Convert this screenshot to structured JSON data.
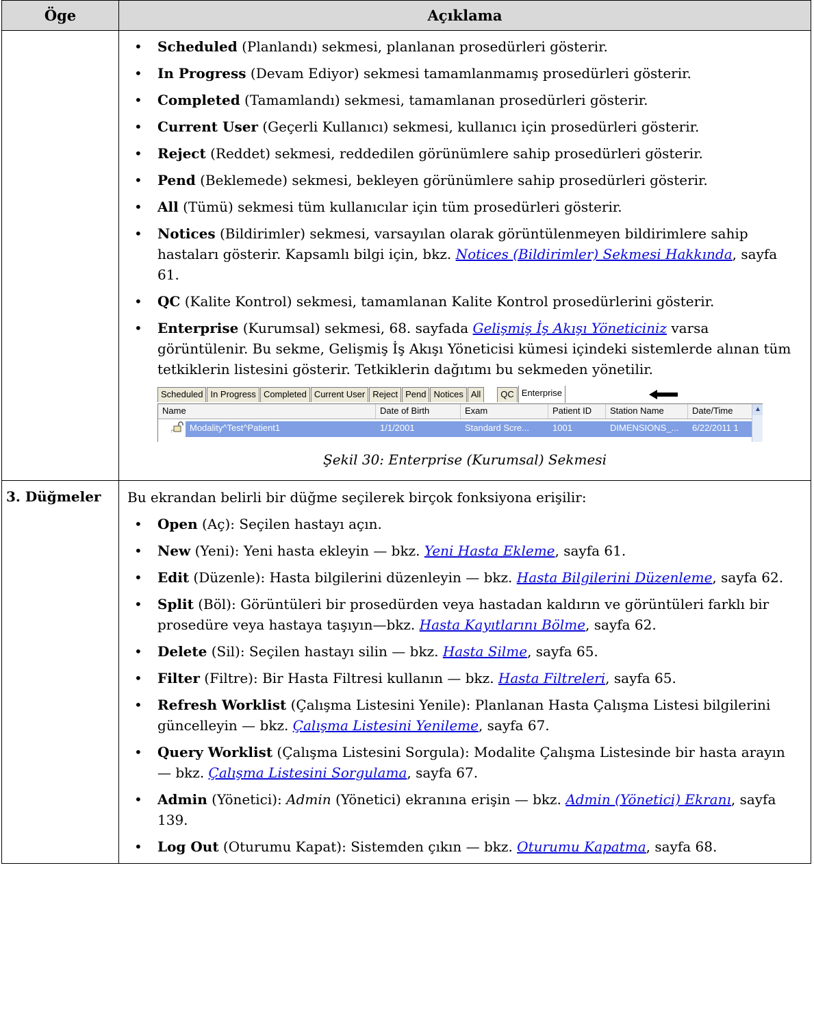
{
  "header": {
    "col1": "Öge",
    "col2": "Açıklama"
  },
  "tabs_section": {
    "items": [
      {
        "bold": "Scheduled",
        "rest": " (Planlandı) sekmesi, planlanan prosedürleri gösterir."
      },
      {
        "bold": "In Progress",
        "rest": " (Devam Ediyor) sekmesi tamamlanmamış prosedürleri gösterir."
      },
      {
        "bold": "Completed",
        "rest": " (Tamamlandı) sekmesi, tamamlanan prosedürleri gösterir."
      },
      {
        "bold": "Current User",
        "rest": " (Geçerli Kullanıcı) sekmesi, kullanıcı için prosedürleri gösterir."
      },
      {
        "bold": "Reject",
        "rest": " (Reddet) sekmesi, reddedilen görünümlere sahip prosedürleri gösterir."
      },
      {
        "bold": "Pend",
        "rest": " (Beklemede) sekmesi, bekleyen görünümlere sahip prosedürleri gösterir."
      },
      {
        "bold": "All",
        "rest": " (Tümü) sekmesi tüm kullanıcılar için tüm prosedürleri gösterir."
      },
      {
        "bold": "Notices",
        "rest": " (Bildirimler) sekmesi, varsayılan olarak görüntülenmeyen bildirimlere sahip hastaları gösterir. Kapsamlı bilgi için, bkz. ",
        "link": "Notices (Bildirimler) Sekmesi Hakkında",
        "after": ", sayfa 61."
      },
      {
        "bold": "QC",
        "rest": " (Kalite Kontrol) sekmesi, tamamlanan Kalite Kontrol prosedürlerini gösterir."
      },
      {
        "bold": "Enterprise",
        "rest": " (Kurumsal) sekmesi, 68. sayfada ",
        "link": "Gelişmiş İş Akışı Yöneticiniz",
        "after": " varsa görüntülenir. Bu sekme, Gelişmiş İş Akışı Yöneticisi kümesi içindeki sistemlerde alınan tüm tetkiklerin listesini gösterir. Tetkiklerin dağıtımı bu sekmeden yönetilir."
      }
    ],
    "figure": {
      "tabs": [
        "Scheduled",
        "In Progress",
        "Completed",
        "Current User",
        "Reject",
        "Pend",
        "Notices",
        "All",
        "QC",
        "Enterprise"
      ],
      "active_tab": "Enterprise",
      "columns": [
        "Name",
        "Date of Birth",
        "Exam",
        "Patient ID",
        "Station Name",
        "Date/Time"
      ],
      "row": [
        "Modality^Test^Patient1",
        "1/1/2001",
        "Standard Scre...",
        "1001",
        "DIMENSIONS_...",
        "6/22/2011 1"
      ],
      "row_color": "#7f9ee3",
      "caption": "Şekil 30: Enterprise (Kurumsal) Sekmesi"
    }
  },
  "buttons_section": {
    "label": "3. Düğmeler",
    "intro": "Bu ekrandan belirli bir düğme seçilerek birçok fonksiyona erişilir:",
    "items": [
      {
        "bold": "Open",
        "rest": " (Aç): Seçilen hastayı açın."
      },
      {
        "bold": "New",
        "rest": " (Yeni): Yeni hasta ekleyin — bkz. ",
        "link": "Yeni Hasta Ekleme",
        "after": ", sayfa 61."
      },
      {
        "bold": "Edit",
        "rest": " (Düzenle): Hasta bilgilerini düzenleyin — bkz. ",
        "link": "Hasta Bilgilerini Düzenleme",
        "after": ", sayfa 62."
      },
      {
        "bold": "Split",
        "rest": " (Böl): Görüntüleri bir prosedürden veya hastadan kaldırın ve görüntüleri farklı bir prosedüre veya hastaya taşıyın—bkz. ",
        "link": "Hasta Kayıtlarını Bölme",
        "after": ", sayfa 62."
      },
      {
        "bold": "Delete",
        "rest": " (Sil): Seçilen hastayı silin — bkz. ",
        "link": "Hasta Silme",
        "after": ", sayfa 65."
      },
      {
        "bold": "Filter",
        "rest": " (Filtre): Bir Hasta Filtresi kullanın — bkz. ",
        "link": "Hasta Filtreleri",
        "after": ", sayfa 65."
      },
      {
        "bold": "Refresh Worklist",
        "rest": " (Çalışma Listesini Yenile): Planlanan Hasta Çalışma Listesi bilgilerini güncelleyin — bkz. ",
        "link": "Çalışma Listesini Yenileme",
        "after": ", sayfa 67."
      },
      {
        "bold": "Query Worklist",
        "rest": " (Çalışma Listesini Sorgula): Modalite Çalışma Listesinde bir hasta arayın — bkz. ",
        "link": "Çalışma Listesini Sorgulama",
        "after": ", sayfa 67."
      },
      {
        "bold": "Admin",
        "rest": " (Yönetici): ",
        "ital": "Admin",
        "rest2": " (Yönetici) ekranına erişin — bkz. ",
        "link": "Admin (Yönetici) Ekranı",
        "after": ", sayfa 139."
      },
      {
        "bold": "Log Out",
        "rest": " (Oturumu Kapat): Sistemden çıkın — bkz. ",
        "link": "Oturumu Kapatma",
        "after": ", sayfa 68."
      }
    ]
  },
  "colors": {
    "header_bg": "#d9d9d9",
    "link": "#0b0bd9"
  }
}
